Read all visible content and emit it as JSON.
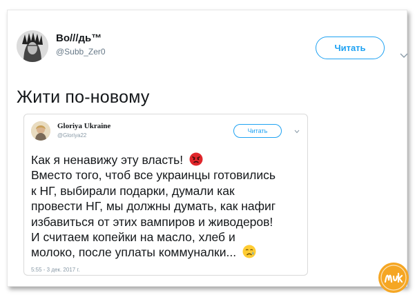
{
  "author": {
    "name": "Bo///дь™",
    "handle": "@Subb_Zer0"
  },
  "follow_button": {
    "label": "Читать"
  },
  "tweet": {
    "text": "Жити по-новому"
  },
  "quoted_tweet": {
    "author_name": "Gloriya Ukraine",
    "author_handle": "@Gloriya22",
    "follow_label": "Читать",
    "lines": [
      "Как я ненавижу эту власть!",
      "Вместо того, чтоб все украинцы готовились",
      "к НГ, выбирали подарки, думали как",
      "провести НГ, мы должны думать, как нафиг",
      "избавиться от этих вампиров и живодеров!",
      "И считаем копейки на масло, хлеб и",
      "молоко, после уплаты коммуналки..."
    ],
    "timestamp": "5:55 - 3 дек. 2017 г."
  },
  "icons": {
    "chevron": "chevron-down-icon",
    "angry": "angry-face-emoji",
    "crying": "crying-face-emoji",
    "watermark": "muka-logo"
  },
  "colors": {
    "accent": "#1da1f2",
    "text": "#14171a",
    "muted": "#657786",
    "watermark": "#f5a623"
  }
}
